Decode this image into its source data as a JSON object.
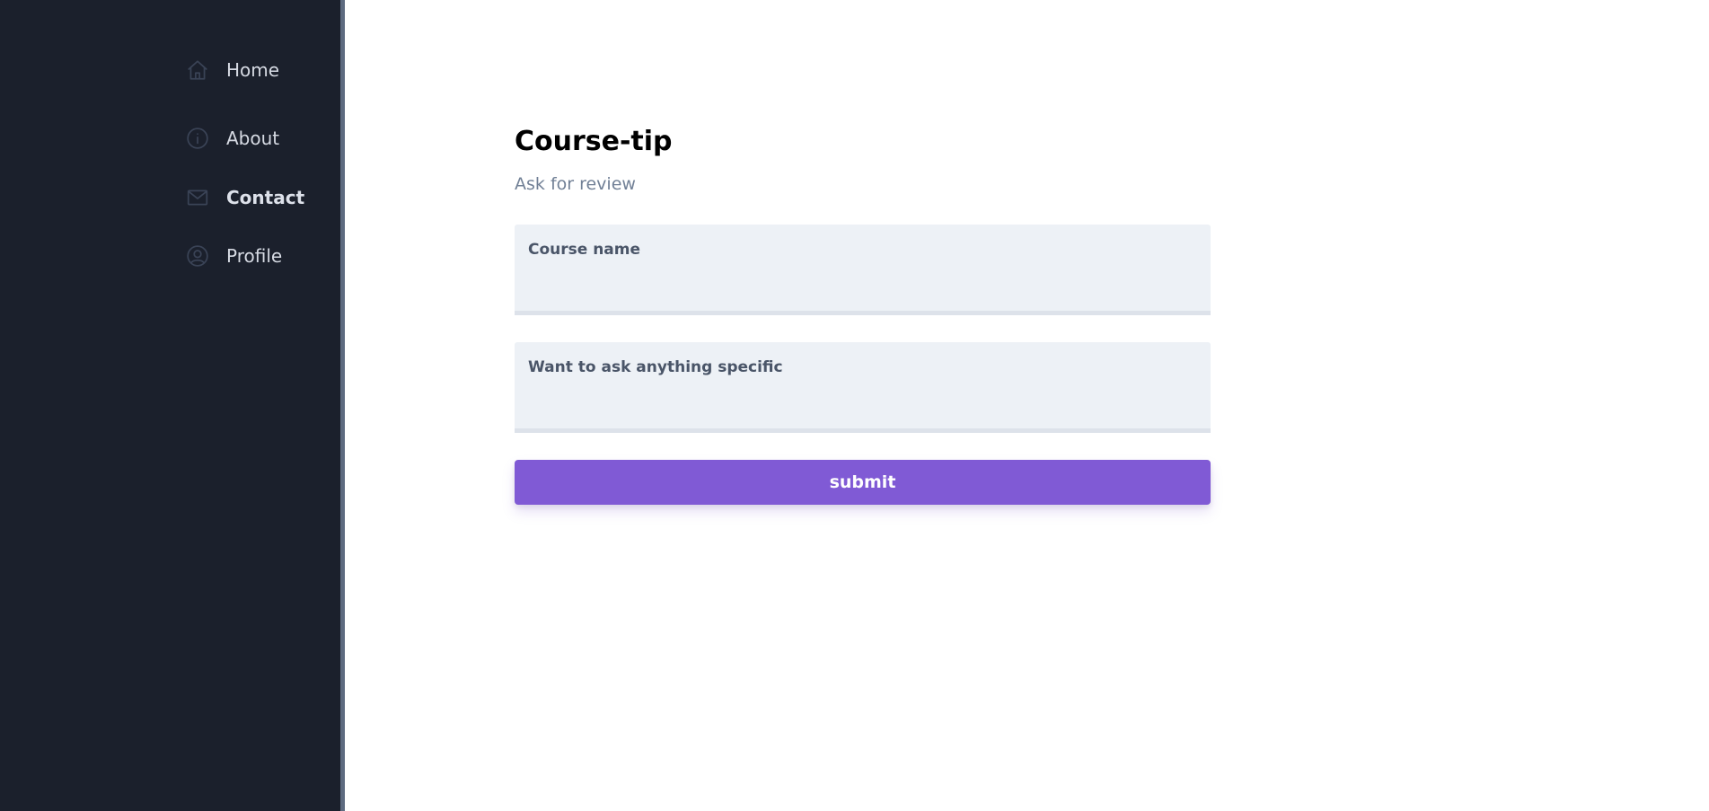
{
  "sidebar": {
    "items": [
      {
        "label": "Home",
        "icon": "home-icon",
        "active": false
      },
      {
        "label": "About",
        "icon": "info-icon",
        "active": false
      },
      {
        "label": "Contact",
        "icon": "mail-icon",
        "active": true
      },
      {
        "label": "Profile",
        "icon": "user-circle-icon",
        "active": false
      }
    ]
  },
  "main": {
    "title": "Course-tip",
    "subtitle": "Ask for review",
    "fields": [
      {
        "label": "Course name",
        "value": "",
        "placeholder": ""
      },
      {
        "label": "Want to ask anything specific",
        "value": "",
        "placeholder": ""
      }
    ],
    "submit_label": "submit"
  },
  "colors": {
    "sidebar_bg": "#1b202c",
    "accent": "#805ad5",
    "field_bg": "#edf1f6"
  }
}
